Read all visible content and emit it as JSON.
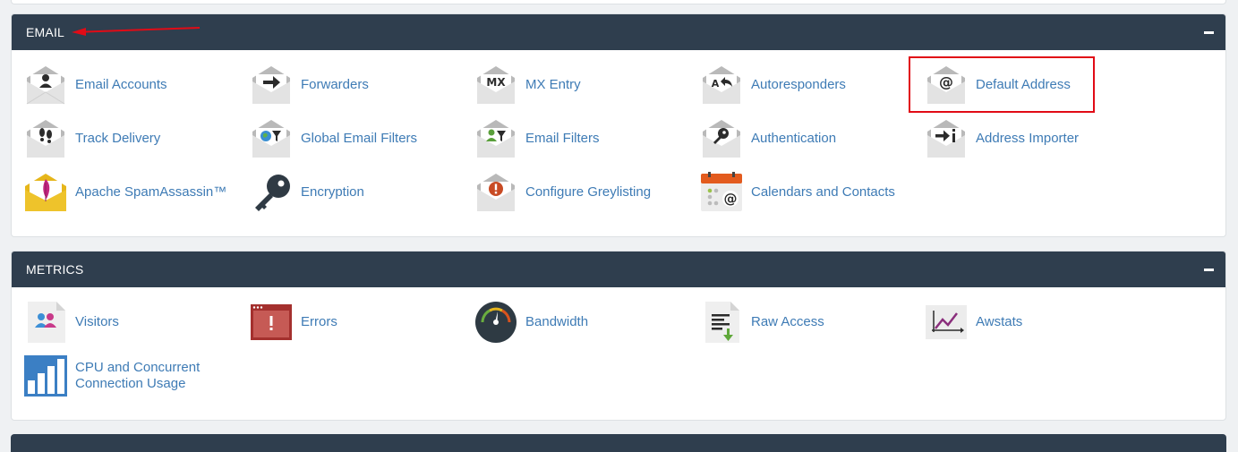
{
  "email": {
    "title": "EMAIL",
    "items": [
      {
        "label": "Email Accounts",
        "icon": "envelope-user-icon"
      },
      {
        "label": "Forwarders",
        "icon": "envelope-forward-icon"
      },
      {
        "label": "MX Entry",
        "icon": "envelope-mx-icon"
      },
      {
        "label": "Autoresponders",
        "icon": "envelope-autoresponder-icon"
      },
      {
        "label": "Default Address",
        "icon": "envelope-at-icon"
      },
      {
        "label": "Track Delivery",
        "icon": "envelope-footprints-icon"
      },
      {
        "label": "Global Email Filters",
        "icon": "envelope-globe-filter-icon"
      },
      {
        "label": "Email Filters",
        "icon": "envelope-user-filter-icon"
      },
      {
        "label": "Authentication",
        "icon": "envelope-key-icon"
      },
      {
        "label": "Address Importer",
        "icon": "envelope-import-icon"
      },
      {
        "label": "Apache SpamAssassin™",
        "icon": "spamassassin-feather-icon"
      },
      {
        "label": "Encryption",
        "icon": "key-icon"
      },
      {
        "label": "Configure Greylisting",
        "icon": "envelope-alert-icon"
      },
      {
        "label": "Calendars and Contacts",
        "icon": "calendar-contacts-icon"
      }
    ]
  },
  "metrics": {
    "title": "METRICS",
    "items": [
      {
        "label": "Visitors",
        "icon": "visitors-icon"
      },
      {
        "label": "Errors",
        "icon": "errors-window-icon"
      },
      {
        "label": "Bandwidth",
        "icon": "gauge-icon"
      },
      {
        "label": "Raw Access",
        "icon": "raw-log-download-icon"
      },
      {
        "label": "Awstats",
        "icon": "awstats-chart-icon"
      },
      {
        "label": "CPU and Concurrent Connection Usage",
        "icon": "bar-chart-icon"
      }
    ]
  },
  "colors": {
    "header_bg": "#2f3e4e",
    "link": "#3e7bb5",
    "annotation": "#e10b16"
  }
}
